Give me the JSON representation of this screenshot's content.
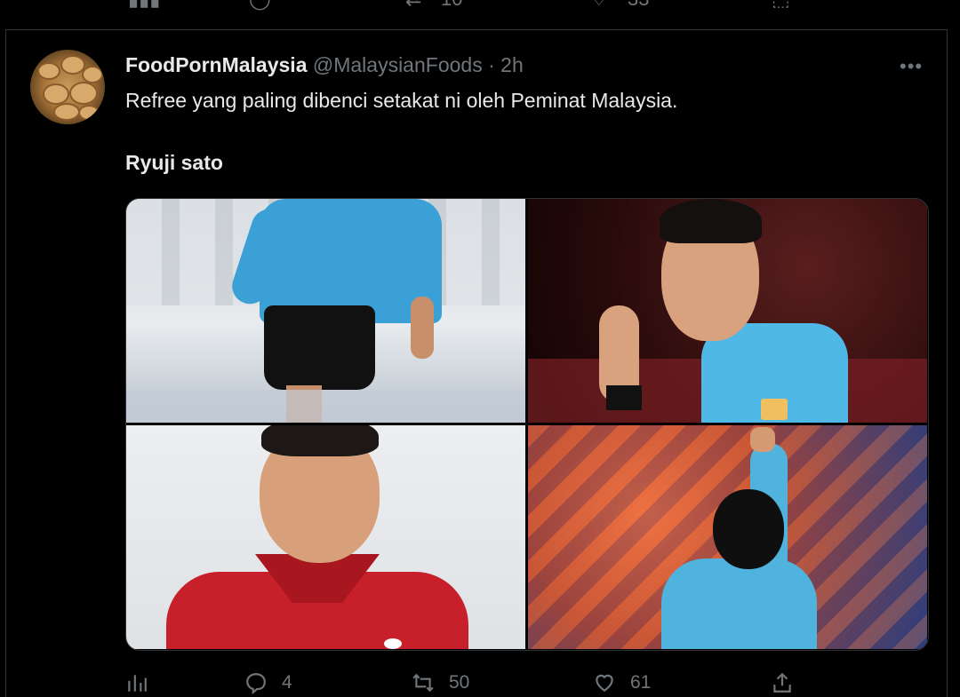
{
  "previous_tweet": {
    "actions": [
      {
        "name": "reply-count",
        "value": ""
      },
      {
        "name": "retweet-count",
        "value": "10"
      },
      {
        "name": "like-count",
        "value": "33"
      }
    ]
  },
  "tweet": {
    "display_name": "FoodPornMalaysia",
    "handle": "@MalaysianFoods",
    "separator": " · ",
    "time": "2h",
    "more": "•••",
    "text_line1": "Refree yang paling dibenci setakat ni oleh Peminat Malaysia.",
    "text_line2": "Ryuji sato",
    "photos": [
      {
        "id": "referee-running"
      },
      {
        "id": "referee-whistle"
      },
      {
        "id": "referee-portrait-red-shirt"
      },
      {
        "id": "referee-raising-arm"
      }
    ],
    "actions": {
      "views": "",
      "replies": "4",
      "retweets": "50",
      "likes": "61"
    }
  },
  "colors": {
    "background": "#000000",
    "text_primary": "#e7e9ea",
    "text_secondary": "#71767b",
    "border": "#2f3336",
    "referee_shirt": "#3aa0d6"
  }
}
